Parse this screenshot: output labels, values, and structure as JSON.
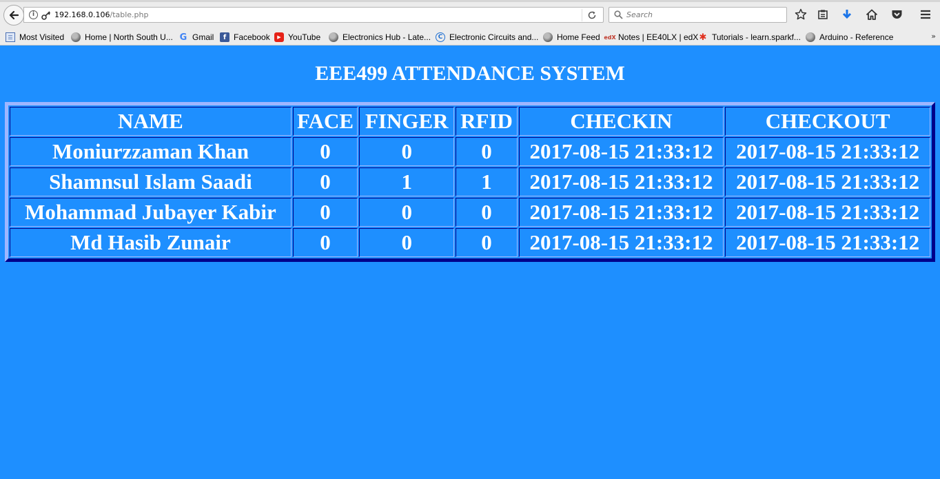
{
  "browser": {
    "url_host": "192.168.0.106",
    "url_path": "/table.php",
    "search_placeholder": "Search"
  },
  "bookmarks": [
    {
      "label": "Most Visited",
      "icon": "most-visited-icon"
    },
    {
      "label": "Home | North South U...",
      "icon": "globe-icon"
    },
    {
      "label": "Gmail",
      "icon": "google-icon"
    },
    {
      "label": "Facebook",
      "icon": "facebook-icon"
    },
    {
      "label": "YouTube",
      "icon": "youtube-icon"
    },
    {
      "label": "Electronics Hub - Late...",
      "icon": "globe-icon"
    },
    {
      "label": "Electronic Circuits and...",
      "icon": "circuits-icon"
    },
    {
      "label": "Home Feed",
      "icon": "globe-icon"
    },
    {
      "label": "Notes | EE40LX | edX",
      "icon": "edx-icon"
    },
    {
      "label": "Tutorials - learn.sparkf...",
      "icon": "sparkfun-icon"
    },
    {
      "label": "Arduino - Reference",
      "icon": "globe-icon"
    }
  ],
  "page": {
    "title": "EEE499 ATTENDANCE SYSTEM"
  },
  "table": {
    "headers": [
      "NAME",
      "FACE",
      "FINGER",
      "RFID",
      "CHECKIN",
      "CHECKOUT"
    ],
    "rows": [
      [
        "Moniurzzaman Khan",
        "0",
        "0",
        "0",
        "2017-08-15 21:33:12",
        "2017-08-15 21:33:12"
      ],
      [
        "Shamnsul Islam Saadi",
        "0",
        "1",
        "1",
        "2017-08-15 21:33:12",
        "2017-08-15 21:33:12"
      ],
      [
        "Mohammad Jubayer Kabir",
        "0",
        "0",
        "0",
        "2017-08-15 21:33:12",
        "2017-08-15 21:33:12"
      ],
      [
        "Md Hasib Zunair",
        "0",
        "0",
        "0",
        "2017-08-15 21:33:12",
        "2017-08-15 21:33:12"
      ]
    ]
  },
  "colors": {
    "page_background": "#1e8fff",
    "text": "#ffffff",
    "border_light": "#9eb6ff",
    "border_dark": "#00008b"
  }
}
